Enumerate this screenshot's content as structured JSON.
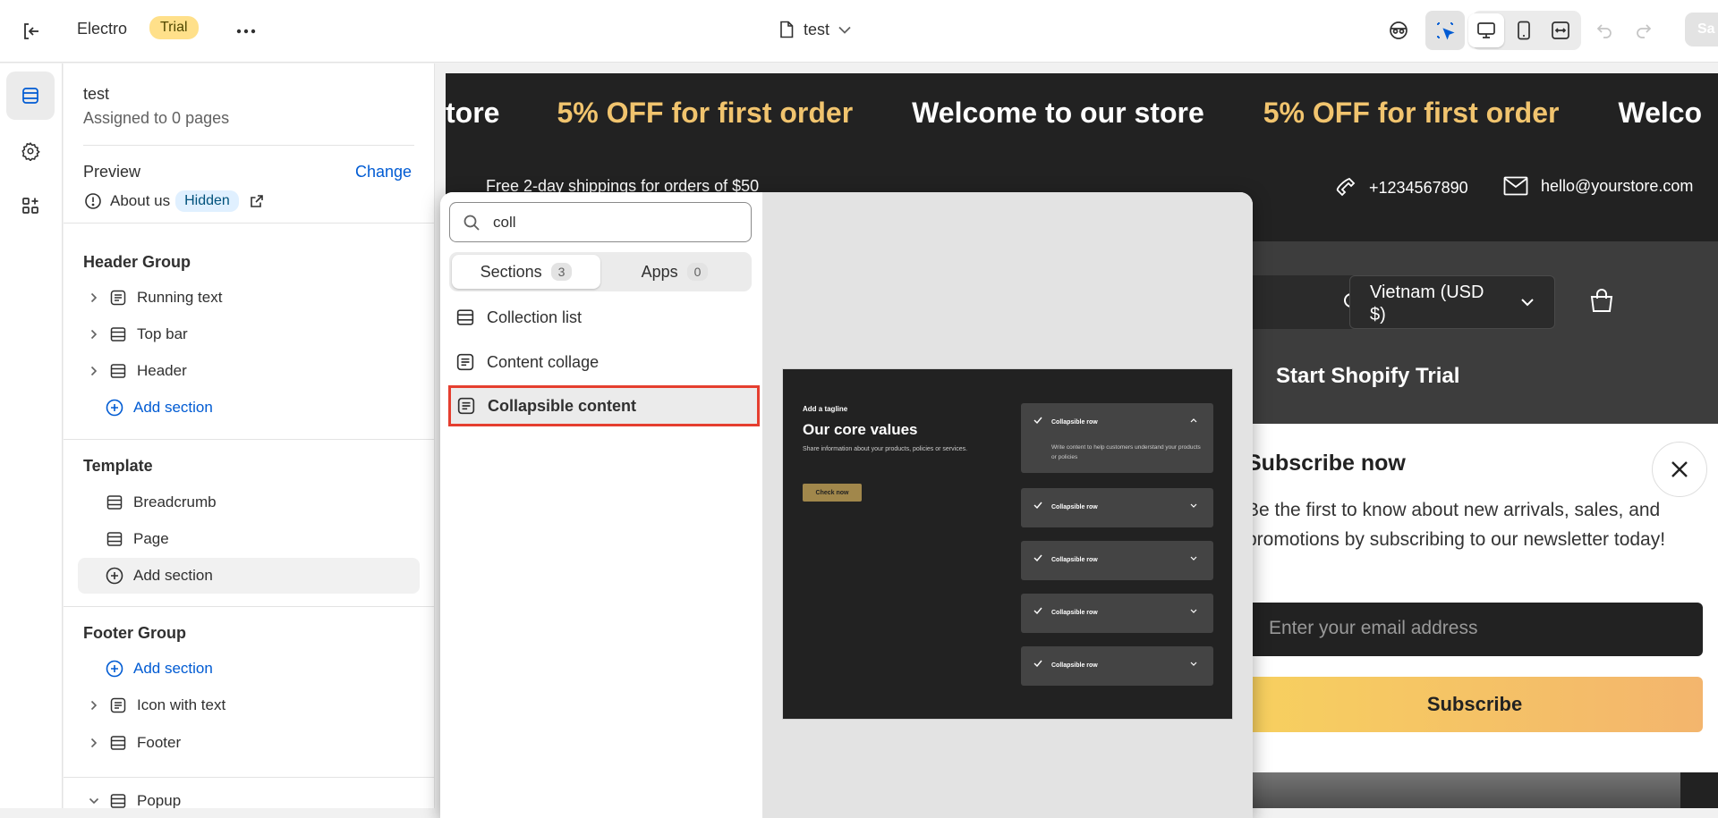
{
  "topbar": {
    "store_name": "Electro",
    "plan_badge": "Trial",
    "page_name": "test",
    "save_label": "Sa"
  },
  "panel": {
    "template_name": "test",
    "assigned": "Assigned to 0 pages",
    "preview_label": "Preview",
    "change_label": "Change",
    "preview_page": "About us",
    "preview_status": "Hidden",
    "header_group": {
      "title": "Header Group",
      "items": [
        "Running text",
        "Top bar",
        "Header"
      ],
      "add": "Add section"
    },
    "template": {
      "title": "Template",
      "items": [
        "Breadcrumb",
        "Page"
      ],
      "add": "Add section"
    },
    "footer_group": {
      "title": "Footer Group",
      "add": "Add section",
      "items": [
        "Icon with text",
        "Footer"
      ]
    },
    "popup_item": "Popup"
  },
  "picker": {
    "search_value": "coll",
    "tabs": [
      {
        "label": "Sections",
        "count": "3"
      },
      {
        "label": "Apps",
        "count": "0"
      }
    ],
    "results": [
      "Collection list",
      "Content collage",
      "Collapsible content"
    ],
    "selected_index": 2,
    "preview": {
      "tagline": "Add a tagline",
      "title": "Our core values",
      "description": "Share information about your products, policies or services.",
      "button": "Check now",
      "rows": [
        "Collapsible row",
        "Collapsible row",
        "Collapsible row",
        "Collapsible row",
        "Collapsible row"
      ],
      "open_row_text": "Write content to help customers understand your products or policies"
    }
  },
  "store_preview": {
    "marquee": [
      "tore",
      "5% OFF for first order",
      "Welcome to our store",
      "5% OFF for first order",
      "Welco"
    ],
    "shipping": "Free 2-day shippings for orders of $50",
    "phone": "+1234567890",
    "email": "hello@yourstore.com",
    "country": "Vietnam (USD $)",
    "trial_link": "Start Shopify Trial",
    "popup": {
      "title": "Subscribe now",
      "text": "Be the first to know about new arrivals, sales, and promotions by subscribing to our newsletter today!",
      "email_placeholder": "Enter your email address",
      "button": "Subscribe"
    }
  },
  "colors": {
    "accent_blue": "#005bd3",
    "selection_red": "#e53e2f",
    "gold": "#f1c46e"
  }
}
